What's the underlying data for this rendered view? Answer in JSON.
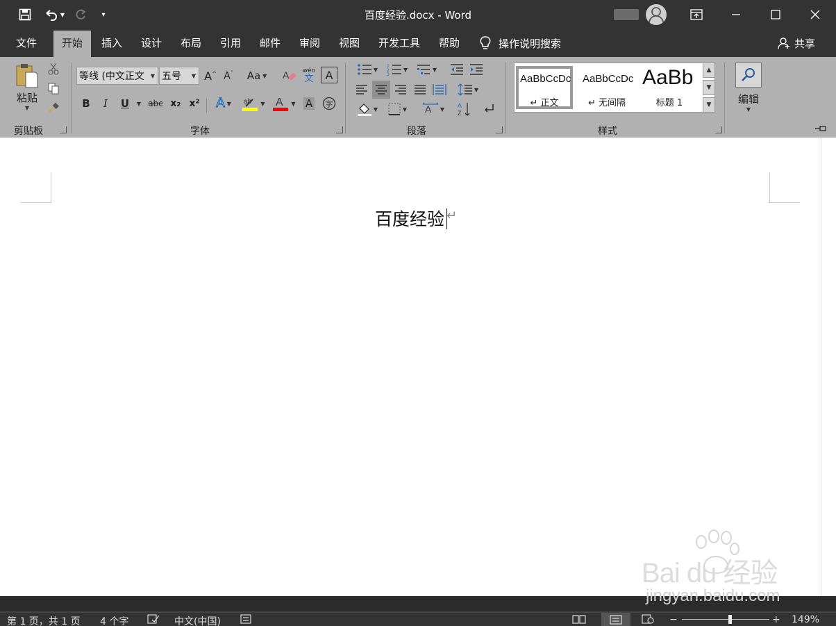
{
  "window": {
    "title": "百度经验.docx  -  Word"
  },
  "tabs": [
    {
      "label": "文件"
    },
    {
      "label": "开始"
    },
    {
      "label": "插入"
    },
    {
      "label": "设计"
    },
    {
      "label": "布局"
    },
    {
      "label": "引用"
    },
    {
      "label": "邮件"
    },
    {
      "label": "审阅"
    },
    {
      "label": "视图"
    },
    {
      "label": "开发工具"
    },
    {
      "label": "帮助"
    }
  ],
  "tell_me": {
    "label": "操作说明搜索"
  },
  "share": {
    "label": "共享"
  },
  "ribbon": {
    "clipboard": {
      "paste_label": "粘贴",
      "group_label": "剪贴板"
    },
    "font": {
      "font_name": "等线 (中文正文",
      "font_size": "五号",
      "case_label": "Aa",
      "phonetic_label": "wén",
      "bold": "B",
      "italic": "I",
      "underline": "U",
      "strike": "abc",
      "subscript": "x₂",
      "superscript": "x²",
      "group_label": "字体"
    },
    "paragraph": {
      "group_label": "段落"
    },
    "styles": {
      "items": [
        {
          "sample": "AaBbCcDc",
          "name": "↵ 正文"
        },
        {
          "sample": "AaBbCcDc",
          "name": "↵ 无间隔"
        },
        {
          "sample": "AaBb",
          "name": "标题 1"
        }
      ],
      "group_label": "样式"
    },
    "editing": {
      "label": "编辑"
    }
  },
  "document": {
    "text": "百度经验",
    "paragraph_mark": "↵"
  },
  "watermark": {
    "main": "Bai du 经验",
    "url": "jingyan.baidu.com"
  },
  "statusbar": {
    "page": "第 1 页，共 1 页",
    "words": "4 个字",
    "language": "中文(中国)",
    "zoom": "149%"
  },
  "colors": {
    "titlebar": "#333333",
    "ribbon": "#b1b1b1",
    "highlight": "#ffff00",
    "font_color": "#ff0000"
  }
}
